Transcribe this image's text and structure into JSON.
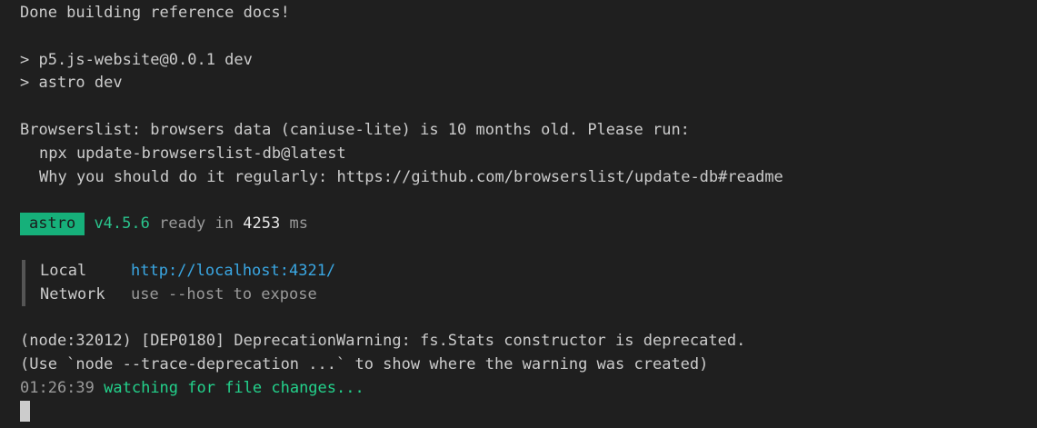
{
  "terminal": {
    "done_msg": "Done building reference docs!",
    "cmd_line1": "> p5.js-website@0.0.1 dev",
    "cmd_line2": "> astro dev",
    "browserslist_warn": "Browserslist: browsers data (caniuse-lite) is 10 months old. Please run:",
    "browserslist_cmd": "npx update-browserslist-db@latest",
    "browserslist_why": "Why you should do it regularly: https://github.com/browserslist/update-db#readme",
    "astro_badge": "astro",
    "astro_version": "v4.5.6",
    "ready_in": "ready in",
    "ready_time": "4253",
    "ready_unit": "ms",
    "local_label": "Local",
    "local_url": "http://localhost:4321/",
    "network_label": "Network",
    "network_value": "use --host to expose",
    "deprecation_warn": "(node:32012) [DEP0180] DeprecationWarning: fs.Stats constructor is deprecated.",
    "deprecation_hint": "(Use `node --trace-deprecation ...` to show where the warning was created)",
    "watch_time": "01:26:39",
    "watch_msg": "watching for file changes..."
  },
  "colors": {
    "background": "#1f1f1f",
    "text": "#cccccc",
    "badge": "#16b07a",
    "green": "#23d18b",
    "link": "#3aa7e3",
    "muted": "#9a9a9a"
  }
}
